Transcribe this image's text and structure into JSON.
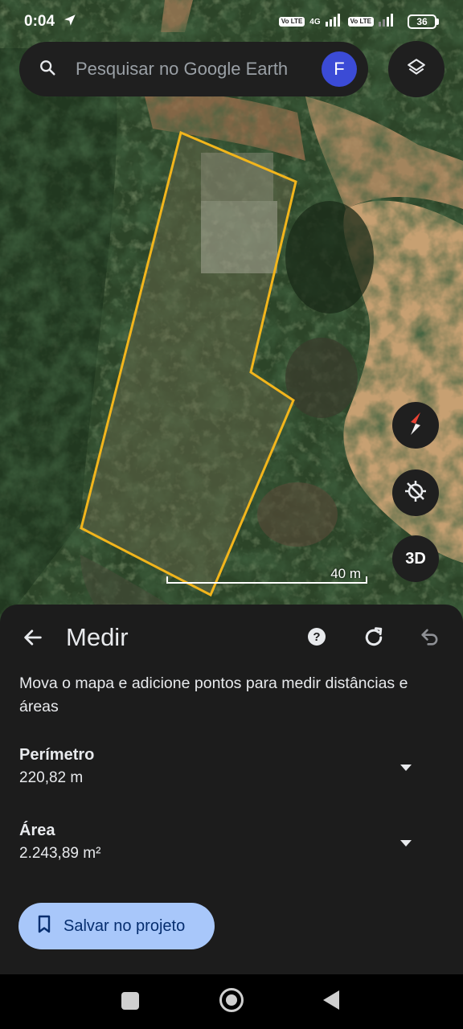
{
  "status_bar": {
    "time": "0:04",
    "volte_1": "Vo LTE",
    "network": "4G",
    "volte_2": "Vo LTE",
    "battery": "36"
  },
  "search": {
    "placeholder": "Pesquisar no Google Earth",
    "avatar_letter": "F"
  },
  "map": {
    "scale_label": "40 m",
    "btn_3d": "3D",
    "outline_color": "#f2b51c"
  },
  "panel": {
    "title": "Medir",
    "instructions": "Mova o mapa e adicione pontos para medir distâncias e áreas",
    "perimeter": {
      "label": "Perímetro",
      "value": "220,82 m"
    },
    "area": {
      "label": "Área",
      "value": "2.243,89 m²"
    },
    "save_label": "Salvar no projeto"
  },
  "colors": {
    "panel_bg": "#1c1c1c",
    "save_button_bg": "#a8c7fa",
    "save_button_text": "#062e6f",
    "avatar_bg": "#3b4bd6"
  }
}
